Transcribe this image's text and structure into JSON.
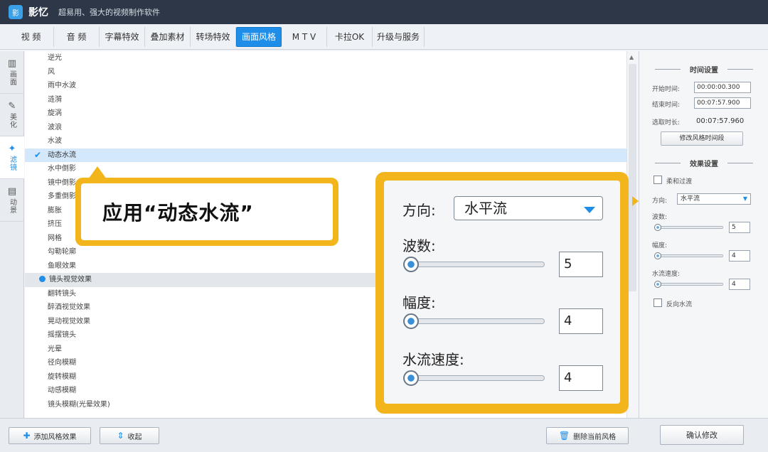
{
  "window": {
    "logo_text": "影",
    "app_name": "影忆",
    "slogan": "超易用、强大的视频制作软件"
  },
  "tabs": [
    {
      "label": "视  频"
    },
    {
      "label": "音  频"
    },
    {
      "label": "字幕特效"
    },
    {
      "label": "叠加素材"
    },
    {
      "label": "转场特效"
    },
    {
      "label": "画面风格",
      "active": true
    },
    {
      "label": "M T V"
    },
    {
      "label": "卡拉OK"
    },
    {
      "label": "升级与服务"
    }
  ],
  "left_tabs": [
    {
      "icon": "▥",
      "label": "画面"
    },
    {
      "icon": "✎",
      "label": "美化"
    },
    {
      "icon": "✦",
      "label": "滤镜",
      "active": true
    },
    {
      "icon": "▤",
      "label": "动景"
    }
  ],
  "effects": {
    "items_before": [
      "逆光",
      "风",
      "雨中水波",
      "涟漪",
      "旋涡",
      "波浪",
      "水波"
    ],
    "selected": "动态水流",
    "items_after": [
      "水中倒影",
      "镜中倒影",
      "多重倒影",
      "膨胀",
      "挤压",
      "网格",
      "勾勒轮廓",
      "鱼眼效果"
    ],
    "group": "镜头视觉效果",
    "group_items": [
      "翻转镜头",
      "醉酒视觉效果",
      "晃动视觉效果",
      "摇摆镜头",
      "光晕",
      "径向模糊",
      "旋转模糊",
      "动感模糊",
      "镜头模糊(光晕效果)"
    ]
  },
  "callout": {
    "text": "应用“动态水流”"
  },
  "zoom": {
    "direction_label": "方向:",
    "direction_value": "水平流",
    "wave_label": "波数:",
    "wave_value": "5",
    "amplitude_label": "幅度:",
    "amplitude_value": "4",
    "speed_label": "水流速度:",
    "speed_value": "4"
  },
  "right_panel": {
    "time_title": "时间设置",
    "start_label": "开始时间:",
    "start_value": "00:00:00.300",
    "end_label": "结束时间:",
    "end_value": "00:07:57.900",
    "duration_label": "选取时长:",
    "duration_value": "00:07:57.960",
    "modify_time_button": "修改风格时间段",
    "effect_title": "效果设置",
    "soft_transition_label": "柔和过渡",
    "direction_label": "方向:",
    "direction_value": "水平流",
    "wave_label": "波数:",
    "wave_value": "5",
    "amplitude_label": "幅度:",
    "amplitude_value": "4",
    "speed_label": "水流速度:",
    "speed_value": "4",
    "reverse_label": "反向水流"
  },
  "bottom": {
    "add_button": "添加风格效果",
    "collapse_button": "收起",
    "delete_button": "删除当前风格",
    "confirm_button": "确认修改"
  },
  "colors": {
    "accent": "#1e8ee8",
    "highlight": "#f2b51c",
    "titlebar": "#2d3747"
  }
}
